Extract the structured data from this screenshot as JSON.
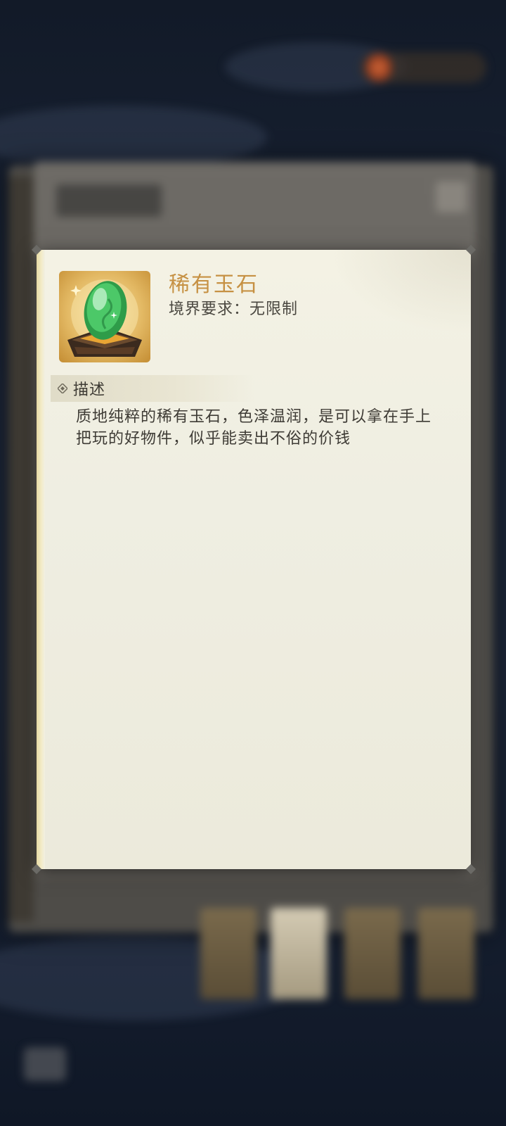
{
  "item": {
    "name": "稀有玉石",
    "requirement": "境界要求：无限制",
    "icon": "jade-stone-icon"
  },
  "description_section": {
    "title": "描述",
    "text": "质地纯粹的稀有玉石，色泽温润，是可以拿在手上把玩的好物件，似乎能卖出不俗的价钱"
  },
  "colors": {
    "name": "#c69143",
    "card": "#efeee2",
    "jade": "#3fb65a"
  }
}
